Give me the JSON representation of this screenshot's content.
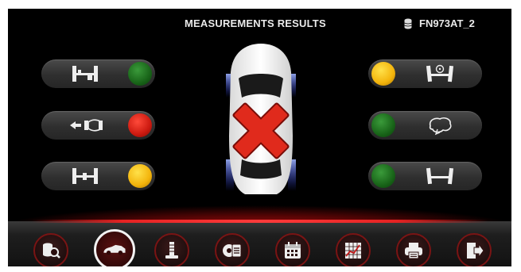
{
  "header": {
    "title": "MEASUREMENTS RESULTS",
    "vehicle_id": "FN973AT_2",
    "vehicle_icon": "database-icon"
  },
  "indicators": [
    {
      "side": "left",
      "icon": "front-axle-toe-icon",
      "status": "green"
    },
    {
      "side": "left",
      "icon": "thrust-angle-icon",
      "status": "red"
    },
    {
      "side": "left",
      "icon": "rear-axle-toe-icon",
      "status": "yellow"
    },
    {
      "side": "right",
      "icon": "steering-camber-icon",
      "status": "yellow"
    },
    {
      "side": "right",
      "icon": "caster-icon",
      "status": "green"
    },
    {
      "side": "right",
      "icon": "rear-camber-icon",
      "status": "green"
    }
  ],
  "overall_result": "fail",
  "nav": [
    {
      "icon": "search-database-icon",
      "active": false
    },
    {
      "icon": "car-icon",
      "active": true
    },
    {
      "icon": "lift-icon",
      "active": false
    },
    {
      "icon": "wheel-clipboard-icon",
      "active": false
    },
    {
      "icon": "calendar-icon",
      "active": false
    },
    {
      "icon": "grid-chart-icon",
      "active": false
    },
    {
      "icon": "printer-icon",
      "active": false
    },
    {
      "icon": "exit-icon",
      "active": false
    }
  ],
  "colors": {
    "green": "#1d7a1d",
    "red": "#d8231a",
    "yellow": "#f3b40c",
    "accent": "#e52222"
  }
}
